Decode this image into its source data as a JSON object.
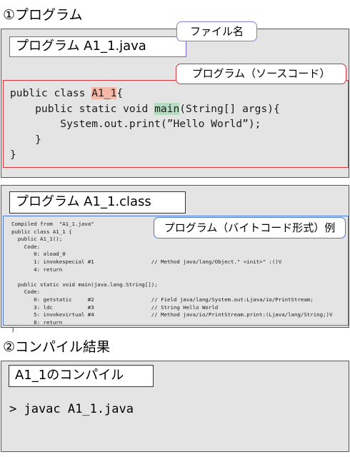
{
  "section1": {
    "title": "①プログラム",
    "file_label": "プログラム A1_1.java",
    "callout_file": "ファイル名",
    "callout_source": "プログラム（ソースコード）",
    "code": {
      "l1_a": "public class ",
      "l1_hl": "A1_1",
      "l1_b": "{",
      "l2_a": "    public static void ",
      "l2_hl": "main",
      "l2_b": "(String[] args){",
      "l3": "        System.out.print(”Hello World”);",
      "l4": "    }",
      "l5": "}"
    }
  },
  "section_class": {
    "file_label": "プログラム A1_1.class",
    "callout": "プログラム（バイトコード形式）例",
    "bytecode": [
      "Compiled from  \"A1_1.java\"",
      "public class A1_1 {",
      "  public A1_1();",
      "    Code:",
      "       0: aload_0",
      "       1: invokespecial #1                  // Method java/lang/Object.\" <init>\" :()V",
      "       4: return",
      "",
      "  public static void main(java.lang.String[]);",
      "    Code:",
      "       0: getstatic     #2                  // Field java/lang/System.out:Ljava/io/PrintStream;",
      "       3: ldc           #3                  // String Hello World",
      "       5: invokevirtual #4                  // Method java/io/PrintStream.print:(Ljava/lang/String;)V",
      "       8: return",
      "}"
    ]
  },
  "section2": {
    "title": "②コンパイル結果",
    "label": "A1_1のコンパイル",
    "command": "> javac A1_1.java"
  }
}
